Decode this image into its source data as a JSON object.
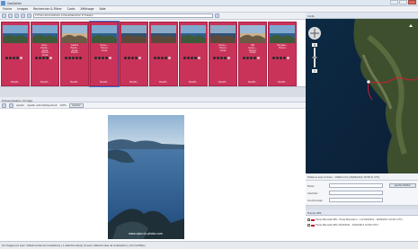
{
  "window": {
    "title": "GeoSetter"
  },
  "menu": [
    "Fichier",
    "Images",
    "Rechercher & Filtrer",
    "Carte",
    "Affichage",
    "Aide"
  ],
  "path": "C:\\France\\Corse\\Porto à Piana\\Sélection 8 Tirées\\x",
  "thumbnails": [
    {
      "date": "15/04/2011 14:...",
      "caption": "",
      "file": "PanoM...",
      "stars": 4,
      "photo": "sea"
    },
    {
      "date": "15/04/2011 14:21:...",
      "caption": "Calvi...\nHaute...\nCorse\nFrance\nCorse",
      "file": "PanoM...",
      "stars": 4,
      "photo": "sea"
    },
    {
      "date": "15/04/2011 14:...",
      "caption": "Galéria\nHaute...\nCorse\nFrance",
      "file": "PanoM...",
      "stars": 5,
      "photo": "town"
    },
    {
      "date": "17/04/2011 14:...",
      "caption": "Corse-...\nFrance\nCorse",
      "file": "PanoM...",
      "stars": 4,
      "photo": "sea"
    },
    {
      "date": "17/04/2011 1:...",
      "caption": "",
      "file": "PanoM...",
      "stars": 4,
      "photo": "coast"
    },
    {
      "date": "17/04/2011 14:...",
      "caption": "",
      "file": "PanoM...",
      "stars": 4,
      "photo": "coast"
    },
    {
      "date": "17/04/2011 14:...",
      "caption": "",
      "file": "PanoM...",
      "stars": 4,
      "photo": "sea"
    },
    {
      "date": "17/04/2011 14:...",
      "caption": "Corse-...\nFrance\nCorse",
      "file": "PanoM...",
      "stars": 4,
      "photo": "coast"
    },
    {
      "date": "19/04/2011 14:...",
      "caption": "Ota\nCorse-...\nFrance\nCorse",
      "file": "PanoM...",
      "stars": 4,
      "photo": "town"
    },
    {
      "date": "19/04/2011 14:...",
      "caption": "Cargèse...\nFrance",
      "file": "PanoM...",
      "stars": 4,
      "photo": "sea"
    }
  ],
  "preview": {
    "header": "Prévisualisation d'image",
    "adjust_label": "Ajuster",
    "auto_label": "Ajuster automatiquement",
    "zoom": "100%",
    "centre_label": "Centrer",
    "watermark": "www.ajaccio-photo.com"
  },
  "map": {
    "header": "Carte",
    "distance": "Distance avec la trace : 14402,2 km (20/04/2011 20:58:11 UTC)",
    "form": {
      "place_label": "Placer",
      "search_label": "Chercher :",
      "coords_label": "Coordonnées :",
      "place_button": "Ajouter Position"
    }
  },
  "gps": {
    "header": "Traces GPS",
    "items": [
      {
        "text": "Traces Manuelle GPS - Traces Manuelle 1 - 4 (15/04/2011 - 20/04/2011 19:40:2 UTC)",
        "color": "#c0102a"
      },
      {
        "text": "Traces Manuelle GPS (15/04/2011 - 20/04/2011 19:40:2 UTC)",
        "color": "#c0102a"
      }
    ]
  },
  "status": "10 image(s) (0 avec métadonnées de localisation) | 1 sélectionnée(s) (0 avec métadonnées de localisation) | 10 modifié(s)"
}
